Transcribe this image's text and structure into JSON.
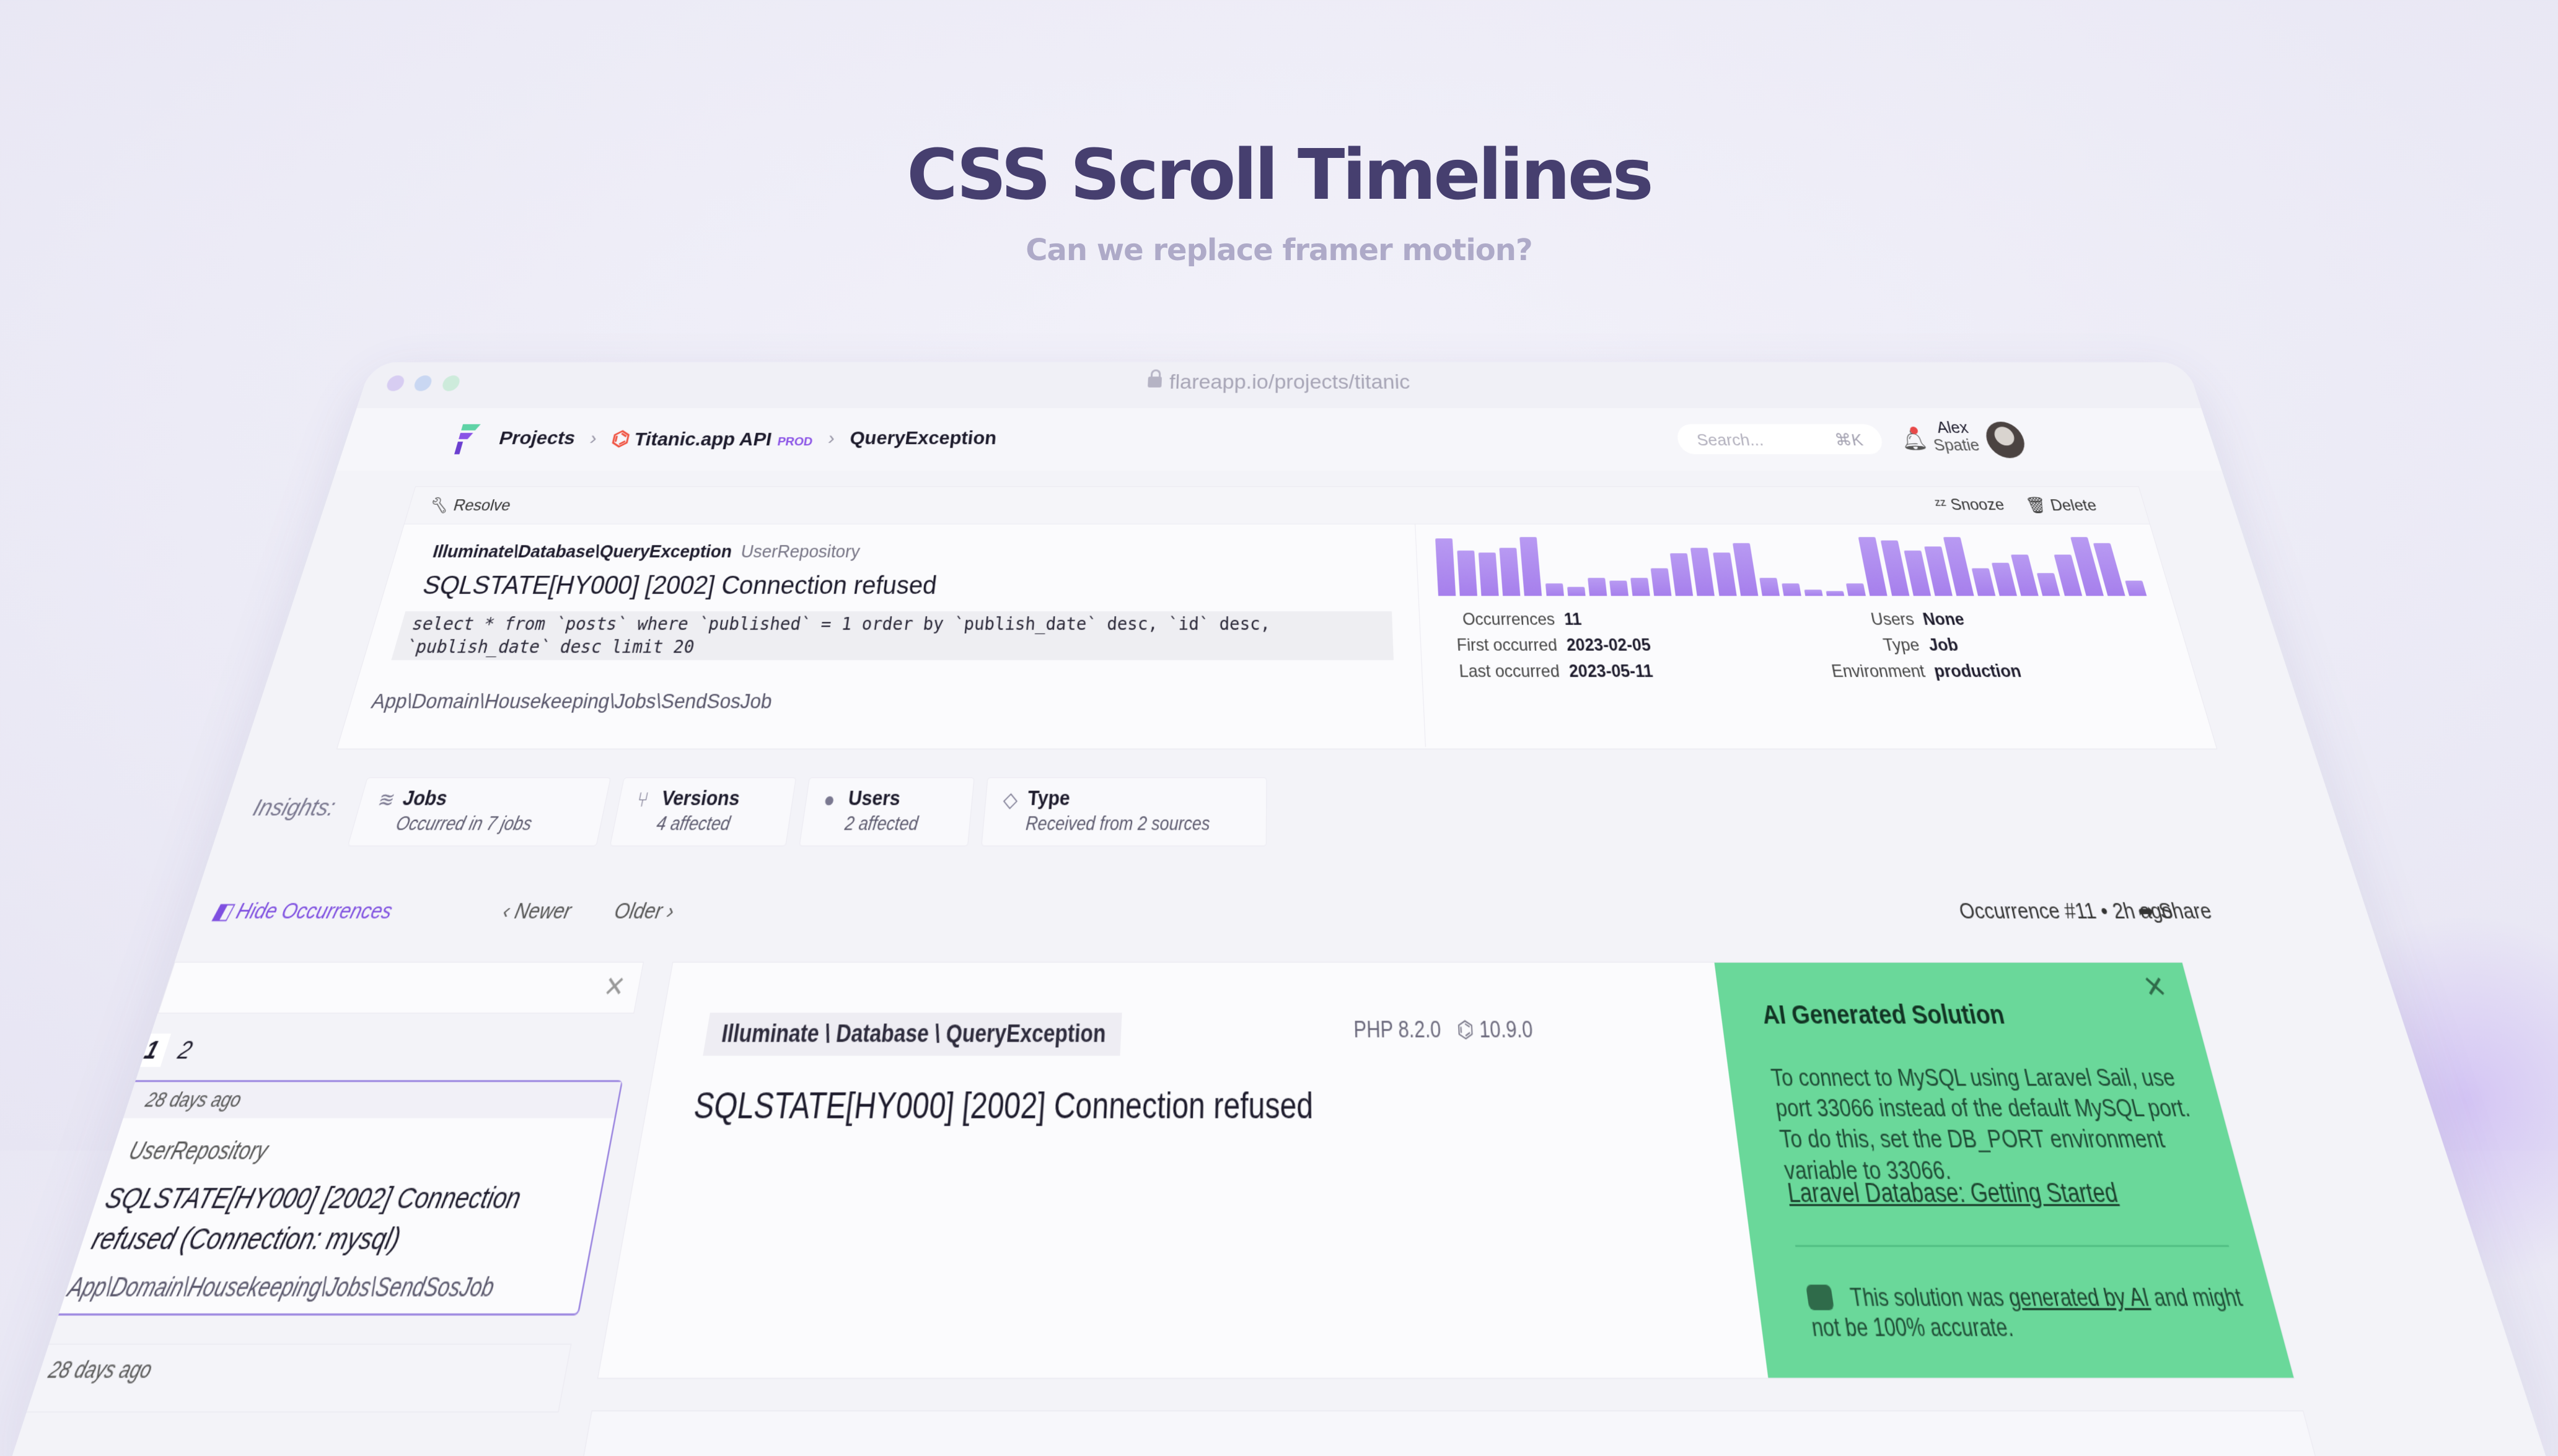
{
  "hero": {
    "title": "CSS Scroll Timelines",
    "subtitle": "Can we replace framer motion?"
  },
  "browser": {
    "url": "flareapp.io/projects/titanic",
    "dot_colors": [
      "#d7cdf2",
      "#c9d7f2",
      "#cdebdb"
    ]
  },
  "nav": {
    "crumbs": [
      "Projects",
      "Titanic.app API",
      "QueryException"
    ],
    "env_badge": "PROD",
    "search_placeholder": "Search...",
    "search_shortcut": "⌘K",
    "user_first": "Alex",
    "user_last": "Spatie"
  },
  "error": {
    "resolve_label": "Resolve",
    "snooze_label": "Snooze",
    "delete_label": "Delete",
    "exception_class": "Illuminate\\Database\\QueryException",
    "repository": "UserRepository",
    "message": "SQLSTATE[HY000] [2002] Connection refused",
    "sql": "select * from `posts` where `published` = 1 order by `publish_date` desc, `id` desc, `publish_date` desc limit 20",
    "path": "App\\Domain\\Housekeeping\\Jobs\\SendSosJob",
    "occurrence_bars": [
      0.95,
      0.75,
      0.72,
      0.8,
      0.98,
      0.2,
      0.15,
      0.3,
      0.25,
      0.3,
      0.45,
      0.7,
      0.8,
      0.72,
      0.88,
      0.3,
      0.2,
      0.1,
      0.08,
      0.2,
      0.98,
      0.92,
      0.75,
      0.82,
      0.98,
      0.45,
      0.55,
      0.68,
      0.38,
      0.68,
      0.98,
      0.88,
      0.25
    ],
    "stats_left": [
      {
        "k": "Occurrences",
        "v": "11"
      },
      {
        "k": "First occurred",
        "v": "2023-02-05"
      },
      {
        "k": "Last occurred",
        "v": "2023-05-11"
      }
    ],
    "stats_right": [
      {
        "k": "Users",
        "v": "None"
      },
      {
        "k": "Type",
        "v": "Job"
      },
      {
        "k": "Environment",
        "v": "production"
      }
    ]
  },
  "insights": {
    "label": "Insights:",
    "cards": [
      {
        "title": "Jobs",
        "sub": "Occurred in 7 jobs"
      },
      {
        "title": "Versions",
        "sub": "4 affected"
      },
      {
        "title": "Users",
        "sub": "2 affected"
      },
      {
        "title": "Type",
        "sub": "Received from 2 sources"
      }
    ]
  },
  "occurrences": {
    "hide_label": "Hide Occurrences",
    "newer_label": "Newer",
    "older_label": "Older",
    "current": "Occurrence #11",
    "time": "2h ago",
    "share_label": "Share",
    "pages": [
      "1",
      "2"
    ],
    "item": {
      "ago": "28 days ago",
      "repo": "UserRepository",
      "message": "SQLSTATE[HY000] [2002] Connection refused (Connection: mysql)",
      "path": "App\\Domain\\Housekeeping\\Jobs\\SendSosJob"
    },
    "item2_ago": "28 days ago"
  },
  "detail": {
    "badge": "Illuminate \\ Database \\ QueryException",
    "message": "SQLSTATE[HY000] [2002] Connection refused",
    "php_version": "PHP 8.2.0",
    "laravel_version": "10.9.0"
  },
  "ai": {
    "title": "AI Generated Solution",
    "body": "To connect to MySQL using Laravel Sail, use port 33066 instead of the default MySQL port. To do this, set the DB_PORT environment variable to 33066.",
    "link": "Laravel Database: Getting Started",
    "note_prefix": "This solution was",
    "note_link": "generated by AI",
    "note_suffix": "and might not be 100% accurate."
  }
}
